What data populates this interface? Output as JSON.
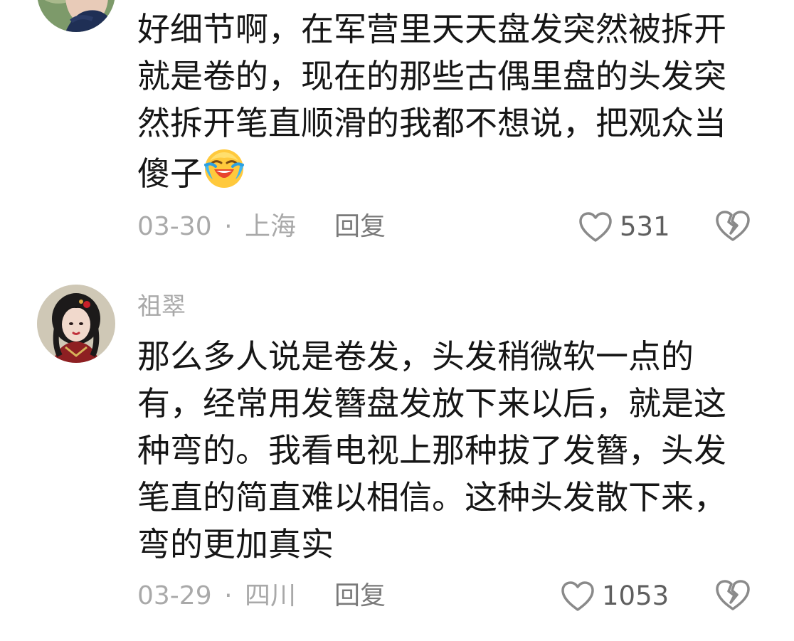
{
  "comments": [
    {
      "text_lines": [
        "好细节啊，在军营里天天盘发突然被拆开",
        "就是卷的，现在的那些古偶里盘的头发突",
        "然拆开笔直顺滑的我都不想说，把观众当",
        "傻子"
      ],
      "emoji_icon": "laughing-crying-emoji",
      "date": "03-30",
      "separator": "·",
      "location": "上海",
      "reply_label": "回复",
      "like_count": "531"
    },
    {
      "username": "祖翠",
      "text_lines": [
        "那么多人说是卷发，头发稍微软一点的",
        "有，经常用发簪盘发放下来以后，就是这",
        "种弯的。我看电视上那种拔了发簪，头发",
        "笔直的简直难以相信。这种头发散下来，",
        "弯的更加真实"
      ],
      "date": "03-29",
      "separator": "·",
      "location": "四川",
      "reply_label": "回复",
      "like_count": "1053"
    }
  ],
  "colors": {
    "text": "#161616",
    "meta": "#a9a9a9",
    "username": "#a8a8a8",
    "icon": "#8a8a8a",
    "background": "#ffffff"
  },
  "icons": {
    "like": "heart-outline-icon",
    "dislike": "broken-heart-icon"
  }
}
